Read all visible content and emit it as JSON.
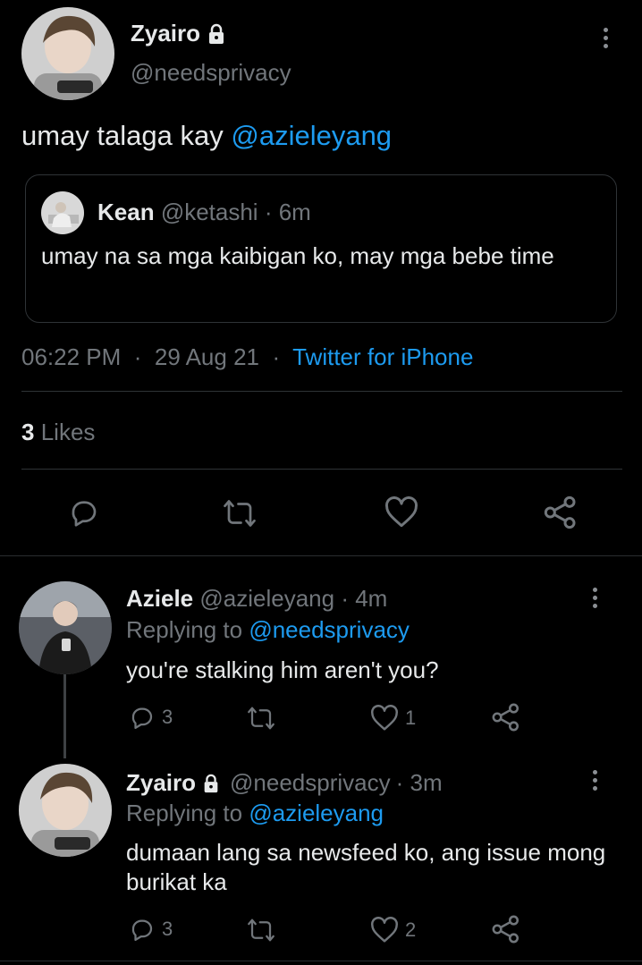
{
  "main_tweet": {
    "display_name": "Zyairo",
    "handle": "@needsprivacy",
    "text_prefix": "umay talaga kay ",
    "mention": "@azieleyang",
    "quote": {
      "display_name": "Kean",
      "handle": "@ketashi",
      "time": "· 6m",
      "text": "umay na sa mga kaibigan ko, may mga bebe time"
    },
    "time": "06:22 PM",
    "date": "29 Aug 21",
    "source": "Twitter for iPhone",
    "likes_count": "3",
    "likes_label": "Likes"
  },
  "replies": [
    {
      "display_name": "Aziele",
      "handle": "@azieleyang",
      "time": "· 4m",
      "replying_label": "Replying to",
      "replying_to": "@needsprivacy",
      "text": "you're stalking him aren't you?",
      "reply_count": "3",
      "like_count": "1"
    },
    {
      "display_name": "Zyairo",
      "handle": "@needsprivacy",
      "time": "· 3m",
      "replying_label": "Replying to",
      "replying_to": "@azieleyang",
      "text": "dumaan lang sa newsfeed ko, ang issue mong burikat ka",
      "reply_count": "3",
      "like_count": "2"
    }
  ],
  "colors": {
    "background": "#000000",
    "text": "#e7e9ea",
    "secondary": "#71767b",
    "accent": "#1d9bf0"
  },
  "icons": [
    "lock-icon",
    "more-icon",
    "reply-icon",
    "retweet-icon",
    "like-icon",
    "share-icon"
  ]
}
